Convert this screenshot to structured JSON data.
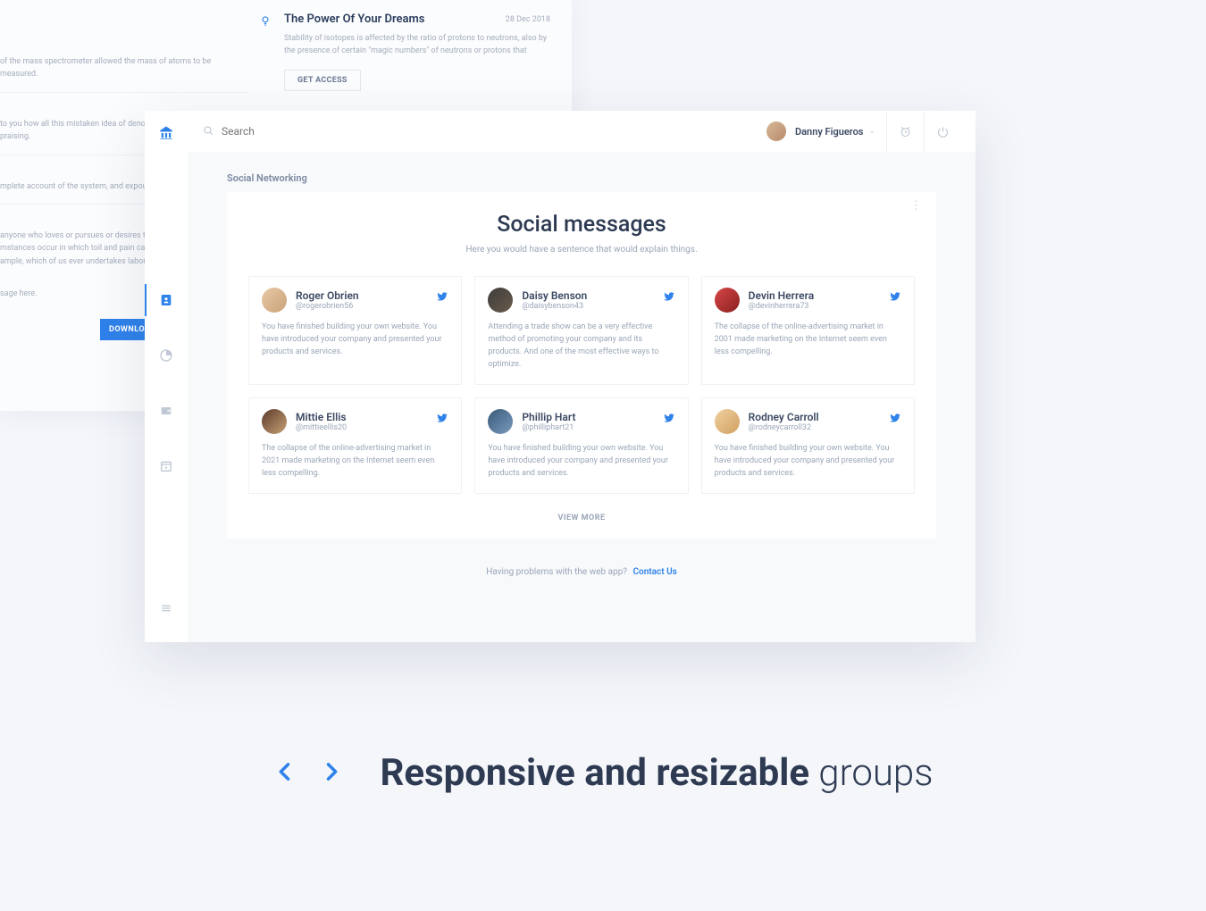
{
  "bg_article": {
    "title": "The Power Of Your Dreams",
    "date": "28 Dec 2018",
    "desc": "Stability of isotopes is affected by the ratio of protons to neutrons, also by the presence of certain \"magic numbers\" of neutrons or protons that",
    "cta": "GET ACCESS"
  },
  "bg_left_fragments": [
    "of the mass spectrometer allowed the mass of atoms to be measured.",
    "to you how all this mistaken idea of denouncing pleasure and praising.",
    "mplete account of the system, and expound the actu",
    "anyone who loves or pursues or desires to obtain pa\nmstances occur in which toil and pain can procure hi\nample, which of us ever undertakes laborious physic",
    "sage here."
  ],
  "bg_download": "DOWNLOAD",
  "topbar": {
    "search_placeholder": "Search",
    "username": "Danny Figueros"
  },
  "subheader": "Social Networking",
  "card": {
    "title": "Social messages",
    "subtitle": "Here you would have a sentence that would explain things.",
    "viewmore": "VIEW MORE"
  },
  "messages": [
    {
      "name": "Roger Obrien",
      "handle": "@rogerobrien56",
      "body": "You have finished building your own website. You have introduced your company and presented your products and services."
    },
    {
      "name": "Daisy Benson",
      "handle": "@daisybenson43",
      "body": "Attending a trade show can be a very effective method of promoting your company and its products. And one of the most effective ways to optimize."
    },
    {
      "name": "Devin Herrera",
      "handle": "@devinherrera73",
      "body": "The collapse of the online-advertising market in 2001 made marketing on the Internet seem even less compelling."
    },
    {
      "name": "Mittie Ellis",
      "handle": "@mittieellis20",
      "body": "The collapse of the online-advertising market in 2021 made marketing on the Internet seem even less compelling."
    },
    {
      "name": "Phillip Hart",
      "handle": "@philliphart21",
      "body": "You have finished building your own website. You have introduced your company and presented your products and services."
    },
    {
      "name": "Rodney Carroll",
      "handle": "@rodneycarroll32",
      "body": "You have finished building your own website. You have introduced your company and presented your products and services."
    }
  ],
  "footer": {
    "text": "Having problems with the web app?",
    "link": "Contact Us"
  },
  "caption": {
    "bold": "Responsive and resizable",
    "light": " groups"
  }
}
